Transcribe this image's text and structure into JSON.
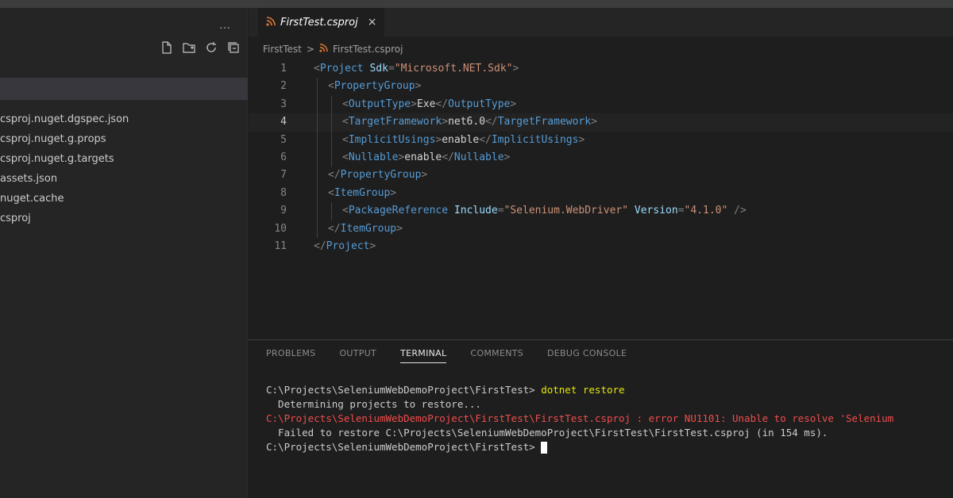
{
  "sidebar": {
    "more_label": "…",
    "actions": [
      "new-file-icon",
      "new-folder-icon",
      "refresh-icon",
      "collapse-all-icon"
    ],
    "items": [
      "csproj.nuget.dgspec.json",
      "csproj.nuget.g.props",
      "csproj.nuget.g.targets",
      "assets.json",
      "nuget.cache",
      "csproj",
      ""
    ]
  },
  "editor": {
    "tab": {
      "name": "FirstTest.csproj",
      "icon": "rss-icon",
      "close": "×"
    },
    "breadcrumb": {
      "folder": "FirstTest",
      "separator": ">",
      "file": "FirstTest.csproj"
    },
    "lines": [
      {
        "n": "1",
        "indent": 0,
        "parts": [
          [
            "br",
            "<"
          ],
          [
            "tag",
            "Project "
          ],
          [
            "attr",
            "Sdk"
          ],
          [
            "br",
            "="
          ],
          [
            "str",
            "\"Microsoft.NET.Sdk\""
          ],
          [
            "br",
            ">"
          ]
        ]
      },
      {
        "n": "2",
        "indent": 1,
        "parts": [
          [
            "br",
            "<"
          ],
          [
            "tag",
            "PropertyGroup"
          ],
          [
            "br",
            ">"
          ]
        ]
      },
      {
        "n": "3",
        "indent": 2,
        "parts": [
          [
            "br",
            "<"
          ],
          [
            "tag",
            "OutputType"
          ],
          [
            "br",
            ">"
          ],
          [
            "plain",
            "Exe"
          ],
          [
            "br",
            "</"
          ],
          [
            "tag",
            "OutputType"
          ],
          [
            "br",
            ">"
          ]
        ]
      },
      {
        "n": "4",
        "indent": 2,
        "active": true,
        "parts": [
          [
            "br",
            "<"
          ],
          [
            "tag",
            "TargetFramework"
          ],
          [
            "br",
            ">"
          ],
          [
            "plain",
            "net6.0"
          ],
          [
            "br",
            "</"
          ],
          [
            "tag",
            "TargetFramework"
          ],
          [
            "br",
            ">"
          ]
        ]
      },
      {
        "n": "5",
        "indent": 2,
        "parts": [
          [
            "br",
            "<"
          ],
          [
            "tag",
            "ImplicitUsings"
          ],
          [
            "br",
            ">"
          ],
          [
            "plain",
            "enable"
          ],
          [
            "br",
            "</"
          ],
          [
            "tag",
            "ImplicitUsings"
          ],
          [
            "br",
            ">"
          ]
        ]
      },
      {
        "n": "6",
        "indent": 2,
        "parts": [
          [
            "br",
            "<"
          ],
          [
            "tag",
            "Nullable"
          ],
          [
            "br",
            ">"
          ],
          [
            "plain",
            "enable"
          ],
          [
            "br",
            "</"
          ],
          [
            "tag",
            "Nullable"
          ],
          [
            "br",
            ">"
          ]
        ]
      },
      {
        "n": "7",
        "indent": 1,
        "parts": [
          [
            "br",
            "</"
          ],
          [
            "tag",
            "PropertyGroup"
          ],
          [
            "br",
            ">"
          ]
        ]
      },
      {
        "n": "8",
        "indent": 1,
        "parts": [
          [
            "br",
            "<"
          ],
          [
            "tag",
            "ItemGroup"
          ],
          [
            "br",
            ">"
          ]
        ]
      },
      {
        "n": "9",
        "indent": 2,
        "parts": [
          [
            "br",
            "<"
          ],
          [
            "tag",
            "PackageReference "
          ],
          [
            "attr",
            "Include"
          ],
          [
            "br",
            "="
          ],
          [
            "str",
            "\"Selenium.WebDriver\""
          ],
          [
            "plain",
            " "
          ],
          [
            "attr",
            "Version"
          ],
          [
            "br",
            "="
          ],
          [
            "str",
            "\"4.1.0\""
          ],
          [
            "br",
            " />"
          ]
        ]
      },
      {
        "n": "10",
        "indent": 1,
        "parts": [
          [
            "br",
            "</"
          ],
          [
            "tag",
            "ItemGroup"
          ],
          [
            "br",
            ">"
          ]
        ]
      },
      {
        "n": "11",
        "indent": 0,
        "parts": [
          [
            "br",
            "</"
          ],
          [
            "tag",
            "Project"
          ],
          [
            "br",
            ">"
          ]
        ]
      }
    ]
  },
  "panel": {
    "tabs": [
      {
        "label": "PROBLEMS",
        "active": false
      },
      {
        "label": "OUTPUT",
        "active": false
      },
      {
        "label": "TERMINAL",
        "active": true
      },
      {
        "label": "COMMENTS",
        "active": false
      },
      {
        "label": "DEBUG CONSOLE",
        "active": false
      }
    ],
    "terminal": {
      "prompt": "C:\\Projects\\SeleniumWebDemoProject\\FirstTest> ",
      "command": "dotnet restore",
      "line2": "  Determining projects to restore...",
      "error": "C:\\Projects\\SeleniumWebDemoProject\\FirstTest\\FirstTest.csproj : error NU1101: Unable to resolve 'Selenium",
      "line4": "  Failed to restore C:\\Projects\\SeleniumWebDemoProject\\FirstTest\\FirstTest.csproj (in 154 ms).",
      "prompt2": "C:\\Projects\\SeleniumWebDemoProject\\FirstTest> "
    }
  },
  "colors": {
    "tag": "#569cd6",
    "attr": "#9cdcfe",
    "string": "#ce9178",
    "error": "#f14c4c"
  }
}
